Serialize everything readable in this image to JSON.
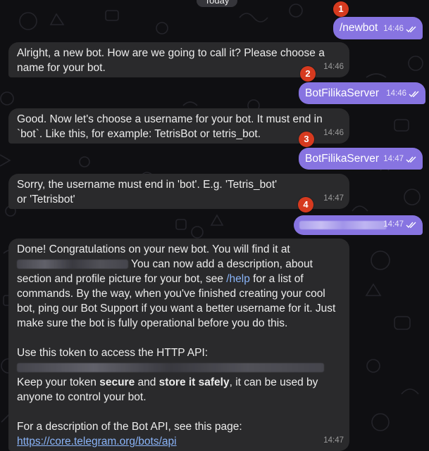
{
  "date_label": "Today",
  "colors": {
    "outgoing": "#8774e1",
    "incoming": "#2a2a2c",
    "badge": "#d63a1f",
    "link": "#8ab4f8"
  },
  "messages": [
    {
      "id": "m1",
      "direction": "out",
      "badge": "1",
      "text": "/newbot",
      "time": "14:46",
      "status": "read"
    },
    {
      "id": "m2",
      "direction": "in",
      "text": "Alright, a new bot. How are we going to call it? Please choose a name for your bot.",
      "time": "14:46"
    },
    {
      "id": "m3",
      "direction": "out",
      "badge": "2",
      "text": "BotFilikaServer",
      "time": "14:46",
      "status": "read"
    },
    {
      "id": "m4",
      "direction": "in",
      "text": "Good. Now let's choose a username for your bot. It must end in `bot`. Like this, for example: TetrisBot or tetris_bot.",
      "time": "14:46"
    },
    {
      "id": "m5",
      "direction": "out",
      "badge": "3",
      "text": "BotFilikaServer",
      "time": "14:47",
      "status": "read"
    },
    {
      "id": "m6",
      "direction": "in",
      "text": "Sorry, the username must end in 'bot'. E.g. 'Tetris_bot' or 'Tetrisbot'",
      "time": "14:47"
    },
    {
      "id": "m7",
      "direction": "out",
      "badge": "4",
      "text_redacted": true,
      "time": "14:47",
      "status": "read"
    },
    {
      "id": "m8",
      "direction": "in",
      "time": "14:47",
      "line1": "Done! Congratulations on your new bot. You will find it at",
      "line2_after_redaction": "You can now add a description, about",
      "part_a": "section and profile picture for your bot, see ",
      "help_command": "/help",
      "part_b": " for a list of commands. By the way, when you've finished creating your cool bot, ping our Bot Support if you want a better username for it. Just make sure the bot is fully operational before you do this.",
      "token_intro": "Use this token to access the HTTP API:",
      "keep_prefix": "Keep your token ",
      "keep_bold1": "secure",
      "keep_mid": " and ",
      "keep_bold2": "store it safely",
      "keep_suffix": ", it can be used by anyone to control your bot.",
      "api_intro": "For a description of the Bot API, see this page:",
      "api_url": "https://core.telegram.org/bots/api"
    }
  ]
}
